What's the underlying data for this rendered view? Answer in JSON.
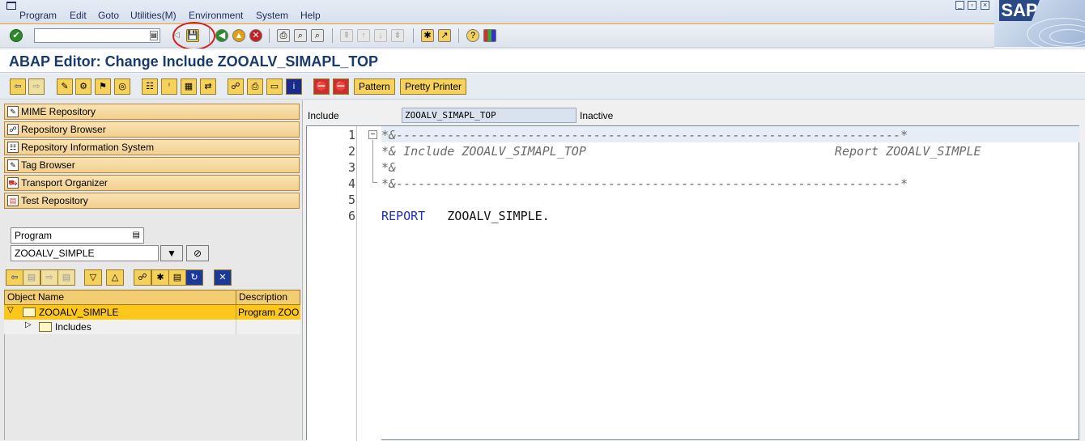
{
  "menubar": {
    "items": [
      "Program",
      "Edit",
      "Goto",
      "Utilities(M)",
      "Environment",
      "System",
      "Help"
    ],
    "logo": "SAP"
  },
  "command_field": {
    "value": ""
  },
  "title": "ABAP Editor: Change Include ZOOALV_SIMAPL_TOP",
  "app_toolbar": {
    "pattern_label": "Pattern",
    "pretty_printer_label": "Pretty Printer"
  },
  "nav": {
    "items": [
      {
        "label": "MIME Repository",
        "icon": "mime-icon"
      },
      {
        "label": "Repository Browser",
        "icon": "hierarchy-icon"
      },
      {
        "label": "Repository Information System",
        "icon": "info-system-icon"
      },
      {
        "label": "Tag Browser",
        "icon": "tag-icon"
      },
      {
        "label": "Transport Organizer",
        "icon": "truck-icon"
      },
      {
        "label": "Test Repository",
        "icon": "test-icon"
      }
    ]
  },
  "object_selector": {
    "type_value": "Program",
    "name_value": "ZOOALV_SIMPLE"
  },
  "tree": {
    "columns": [
      "Object Name",
      "Description"
    ],
    "rows": [
      {
        "name": "ZOOALV_SIMPLE",
        "description": "Program ZOO"
      },
      {
        "name": "Includes",
        "description": ""
      }
    ]
  },
  "editor": {
    "include_label": "Include",
    "include_value": "ZOOALV_SIMAPL_TOP",
    "status": "Inactive",
    "lines": [
      {
        "num": "1",
        "text": "*&---------------------------------------------------------------------*"
      },
      {
        "num": "2",
        "text": "*& Include ZOOALV_SIMAPL_TOP                                  Report ZOOALV_SIMPLE"
      },
      {
        "num": "3",
        "text": "*&"
      },
      {
        "num": "4",
        "text": "*&---------------------------------------------------------------------*"
      },
      {
        "num": "5",
        "text": ""
      },
      {
        "num": "6",
        "keyword": "REPORT",
        "text": "ZOOALV_SIMPLE."
      }
    ]
  },
  "colors": {
    "accent": "#f0a020",
    "title": "#1a3a6b",
    "keyword": "#1e2cc4",
    "tree_selected": "#fdc71a"
  }
}
